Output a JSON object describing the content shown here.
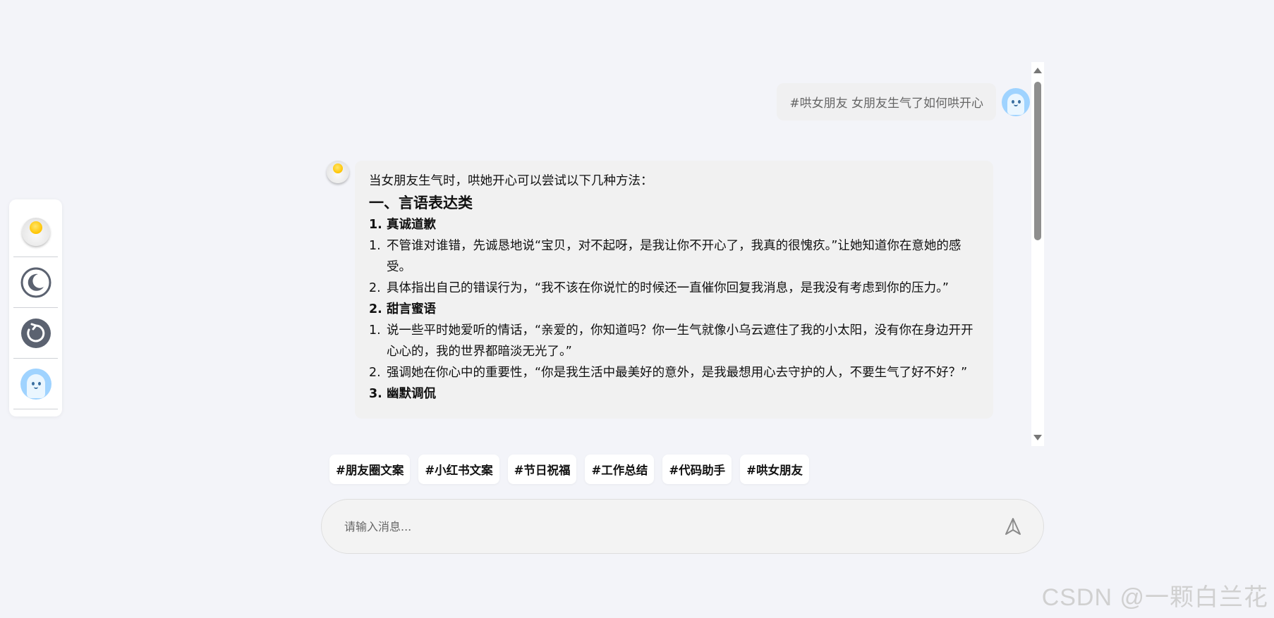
{
  "sidebar": {
    "items": [
      {
        "name": "egg-logo-icon"
      },
      {
        "name": "moon-icon"
      },
      {
        "name": "refresh-icon"
      },
      {
        "name": "ghost-avatar-icon"
      }
    ]
  },
  "chat": {
    "user_message": "#哄女朋友  女朋友生气了如何哄开心",
    "ai_message": {
      "intro": "当女朋友生气时，哄她开心可以尝试以下几种方法：",
      "heading": "一、言语表达类",
      "sections": [
        {
          "num": "1.",
          "title": "真诚道歉",
          "items": [
            {
              "num": "1.",
              "text": "不管谁对谁错，先诚恳地说“宝贝，对不起呀，是我让你不开心了，我真的很愧疚。”让她知道你在意她的感受。"
            },
            {
              "num": "2.",
              "text": "具体指出自己的错误行为，“我不该在你说忙的时候还一直催你回复我消息，是我没有考虑到你的压力。”"
            }
          ]
        },
        {
          "num": "2.",
          "title": "甜言蜜语",
          "items": [
            {
              "num": "1.",
              "text": "说一些平时她爱听的情话，“亲爱的，你知道吗？你一生气就像小乌云遮住了我的小太阳，没有你在身边开开心心的，我的世界都暗淡无光了。”"
            },
            {
              "num": "2.",
              "text": "强调她在你心中的重要性，“你是我生活中最美好的意外，是我最想用心去守护的人，不要生气了好不好？”"
            }
          ]
        },
        {
          "num": "3.",
          "title": "幽默调侃",
          "items": []
        }
      ]
    }
  },
  "tags": [
    "#朋友圈文案",
    "#小红书文案",
    "#节日祝福",
    "#工作总结",
    "#代码助手",
    "#哄女朋友"
  ],
  "input": {
    "placeholder": "请输入消息..."
  },
  "watermark": "CSDN @一颗白兰花"
}
